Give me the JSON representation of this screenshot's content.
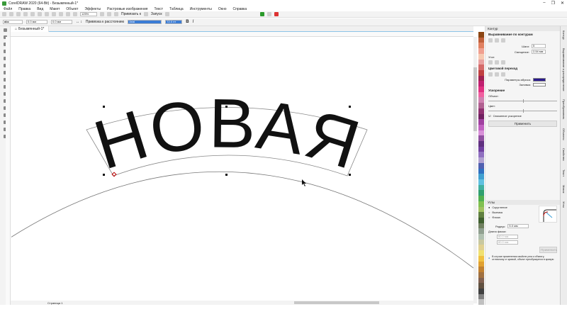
{
  "window": {
    "title": "CorelDRAW 2020 (64-Bit) - Безымянный-1*"
  },
  "menu": [
    "Файл",
    "Правка",
    "Вид",
    "Макет",
    "Объект",
    "Эффекты",
    "Растровые изображения",
    "Текст",
    "Таблица",
    "Инструменты",
    "Окно",
    "Справка"
  ],
  "toolbar": {
    "zoom": "125%",
    "snap": "Привязать к",
    "launch": "Запуск"
  },
  "propbar": {
    "offset_h": "0.0 мм",
    "offset_v": "0.0 мм",
    "place": "Привязка к расстоянию",
    "font": "Arial",
    "font_size": "72.0 пт"
  },
  "doc_tab": "Безымянный-1*",
  "canvas": {
    "text": "НОВАЯ"
  },
  "status": {
    "page": "Страница 1"
  },
  "palette": [
    "#8b4513",
    "#c0603a",
    "#e08060",
    "#f0a090",
    "#f6c8b0",
    "#e8a0a0",
    "#d46a6a",
    "#c04040",
    "#a02050",
    "#c02070",
    "#e03080",
    "#f060a0",
    "#d080b0",
    "#b06090",
    "#903070",
    "#702060",
    "#a040a0",
    "#c060c0",
    "#d890d8",
    "#9050a0",
    "#603080",
    "#7040a0",
    "#9070c0",
    "#b0a0d0",
    "#5060b0",
    "#3070c0",
    "#40a0d0",
    "#60c0e0",
    "#40b0a0",
    "#30a070",
    "#50b050",
    "#80c050",
    "#a0c060",
    "#608040",
    "#406030",
    "#708060",
    "#90a090",
    "#b0c0b0",
    "#c8c8a0",
    "#e0d090",
    "#f0e070",
    "#f0c040",
    "#e0a030",
    "#c08030",
    "#a07040",
    "#806050",
    "#605040",
    "#404040",
    "#808080",
    "#c0c0c0"
  ],
  "docker": {
    "title": "Контур",
    "align_title": "Выравнивание по контурам",
    "step_label": "Шаги:",
    "step_value": "5",
    "offset_label": "Смещение:",
    "offset_value": "2,54 мм",
    "corner_label": "Угол:",
    "color_title": "Цветовой переход",
    "stroke_label": "Параметры абриса:",
    "stroke_color": "#2a1a8c",
    "fill_label": "Заливка:",
    "accel_title": "Ускорение",
    "object_label": "Объект:",
    "color_label": "Цвет:",
    "link_label": "Связанное ускорение",
    "apply": "Применить",
    "corners_title": "Углы",
    "round": "Скругление",
    "scallop": "Выемка",
    "chamfer": "Фаска",
    "radius_label": "Радиус:",
    "radius_value": "5.0 мм",
    "chamfer_len": "Длина фаски:",
    "len1": "80.0 мм",
    "len2": "80.0 мм",
    "apply2": "Применить",
    "info": "В случае применения свойств угла к объекту, отличному от кривой, объект преобразуется в кривую"
  },
  "right_tabs": [
    "Контур",
    "Выравнивание и распределение",
    "Преобразовать",
    "Объекты",
    "Свойства",
    "Текст",
    "Мазок",
    "Углы"
  ]
}
